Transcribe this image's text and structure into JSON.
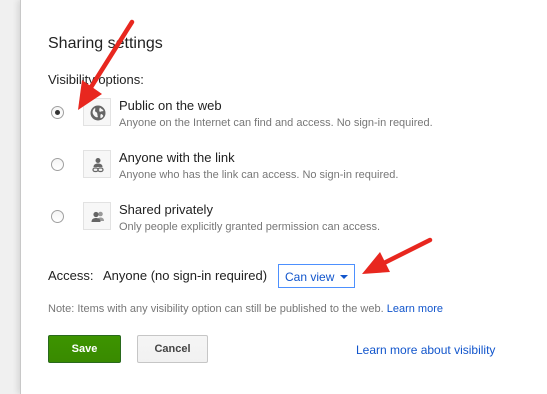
{
  "dialog": {
    "title": "Sharing settings",
    "visibility_label": "Visibility options:"
  },
  "options": [
    {
      "title": "Public on the web",
      "description": "Anyone on the Internet can find and access. No sign-in required.",
      "icon": "globe-icon",
      "selected": true
    },
    {
      "title": "Anyone with the link",
      "description": "Anyone who has the link can access. No sign-in required.",
      "icon": "person-link-icon",
      "selected": false
    },
    {
      "title": "Shared privately",
      "description": "Only people explicitly granted permission can access.",
      "icon": "people-icon",
      "selected": false
    }
  ],
  "access": {
    "label": "Access:",
    "value": "Anyone (no sign-in required)",
    "permission": "Can view"
  },
  "note": {
    "text": "Note: Items with any visibility option can still be published to the web.",
    "link": "Learn more"
  },
  "buttons": {
    "save": "Save",
    "cancel": "Cancel"
  },
  "footer_link": "Learn more about visibility",
  "colors": {
    "save_green": "#3d9400",
    "link_blue": "#1155cc",
    "annotation_red": "#e8271f",
    "select_border": "#4d90fe"
  }
}
